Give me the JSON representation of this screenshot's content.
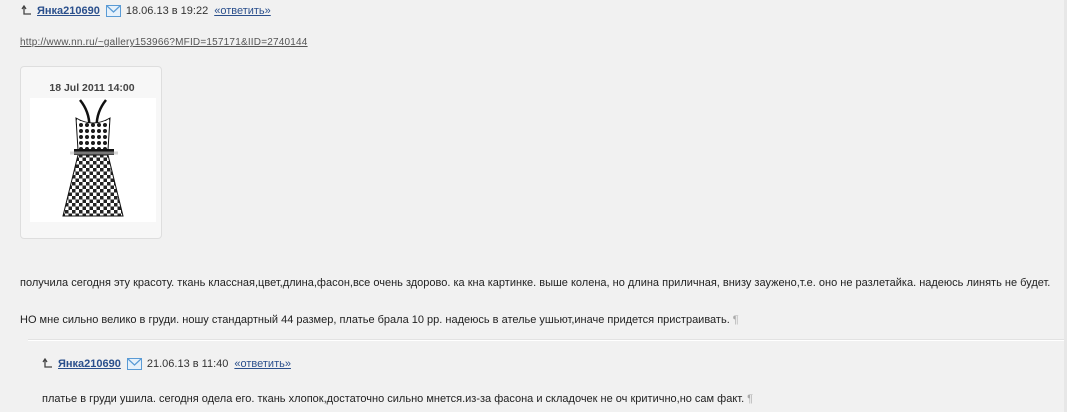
{
  "post": {
    "author": "Янка210690",
    "date": "18.06.13 в 19:22",
    "reply_label": "«ответить»",
    "url": "http://www.nn.ru/~gallery153966?MFID=157171&IID=2740144",
    "photo": {
      "date": "18 Jul 2011 14:00"
    },
    "paragraphs": [
      "получила сегодня эту красоту. ткань классная,цвет,длина,фасон,все очень здорово. ка кна картинке. выше колена, но длина приличная, внизу зауженo,т.е. оно не разлетайка. надеюсь линять не будет.",
      "НО мне сильно велико в груди. ношу стандартный 44 размер, платье брала 10 рр. надеюсь в ателье ушьют,иначе придется пристраивать."
    ],
    "pilcrow": "¶"
  },
  "reply": {
    "author": "Янка210690",
    "date": "21.06.13 в 11:40",
    "reply_label": "«ответить»",
    "text": "платье в груди ушила. сегодня одела его. ткань хлопок,достаточно сильно мнется.из-за фасона и складочек не оч критично,но сам факт.",
    "pilcrow": "¶"
  },
  "colors": {
    "link": "#2a4f8c",
    "background": "#f1f1f1",
    "mail_icon": "#5a9bd5"
  },
  "icons": [
    "thread-arrow-icon",
    "mail-icon",
    "dress-photo"
  ]
}
